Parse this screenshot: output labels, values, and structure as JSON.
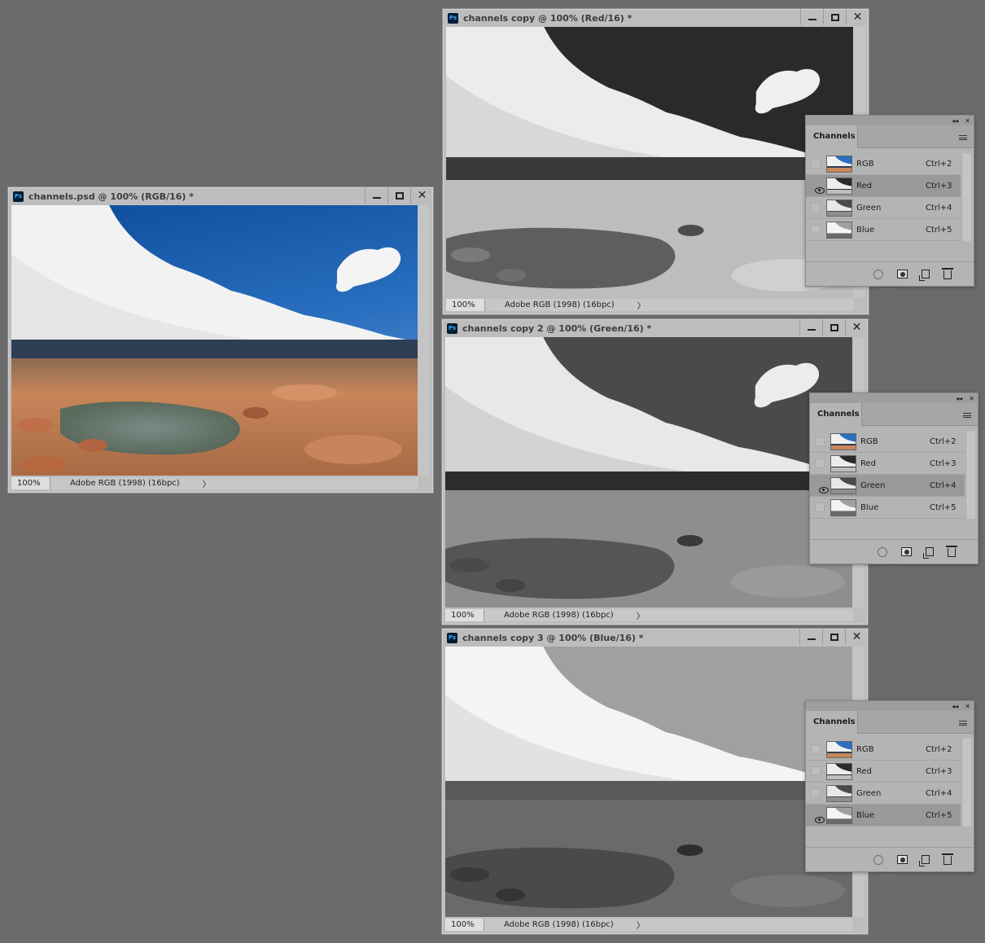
{
  "windows": [
    {
      "title": "channels.psd @ 100% (RGB/16) *",
      "mode": "rgb",
      "zoom": "100%",
      "profile": "Adobe RGB (1998) (16bpc)"
    },
    {
      "title": "channels copy @ 100% (Red/16) *",
      "mode": "red",
      "zoom": "100%",
      "profile": "Adobe RGB (1998) (16bpc)"
    },
    {
      "title": "channels copy 2 @ 100% (Green/16) *",
      "mode": "green",
      "zoom": "100%",
      "profile": "Adobe RGB (1998) (16bpc)"
    },
    {
      "title": "channels copy 3 @ 100% (Blue/16) *",
      "mode": "blue",
      "zoom": "100%",
      "profile": "Adobe RGB (1998) (16bpc)"
    }
  ],
  "ps_icon_label": "Ps",
  "window_controls": {
    "minimize": "minimize-icon",
    "maximize": "maximize-icon",
    "close": "close-icon",
    "close_glyph": "✕"
  },
  "status_chevron": "〉",
  "panels": [
    {
      "tab": "Channels",
      "selected": "Red"
    },
    {
      "tab": "Channels",
      "selected": "Green"
    },
    {
      "tab": "Channels",
      "selected": "Blue"
    }
  ],
  "panel_header": {
    "collapse_glyph": "◂◂",
    "close_glyph": "✕"
  },
  "channels": [
    {
      "name": "RGB",
      "shortcut": "Ctrl+2"
    },
    {
      "name": "Red",
      "shortcut": "Ctrl+3"
    },
    {
      "name": "Green",
      "shortcut": "Ctrl+4"
    },
    {
      "name": "Blue",
      "shortcut": "Ctrl+5"
    }
  ],
  "panel_footer_icons": [
    "load-selection-icon",
    "save-mask-icon",
    "new-channel-icon",
    "delete-channel-icon"
  ],
  "colors": {
    "workspace": "#6b6b6b",
    "window_chrome": "#bdbdbd",
    "panel": "#b4b4b4",
    "selected_row": "#999999",
    "ps_icon_bg": "#001d34",
    "ps_icon_fg": "#31a8ff"
  }
}
